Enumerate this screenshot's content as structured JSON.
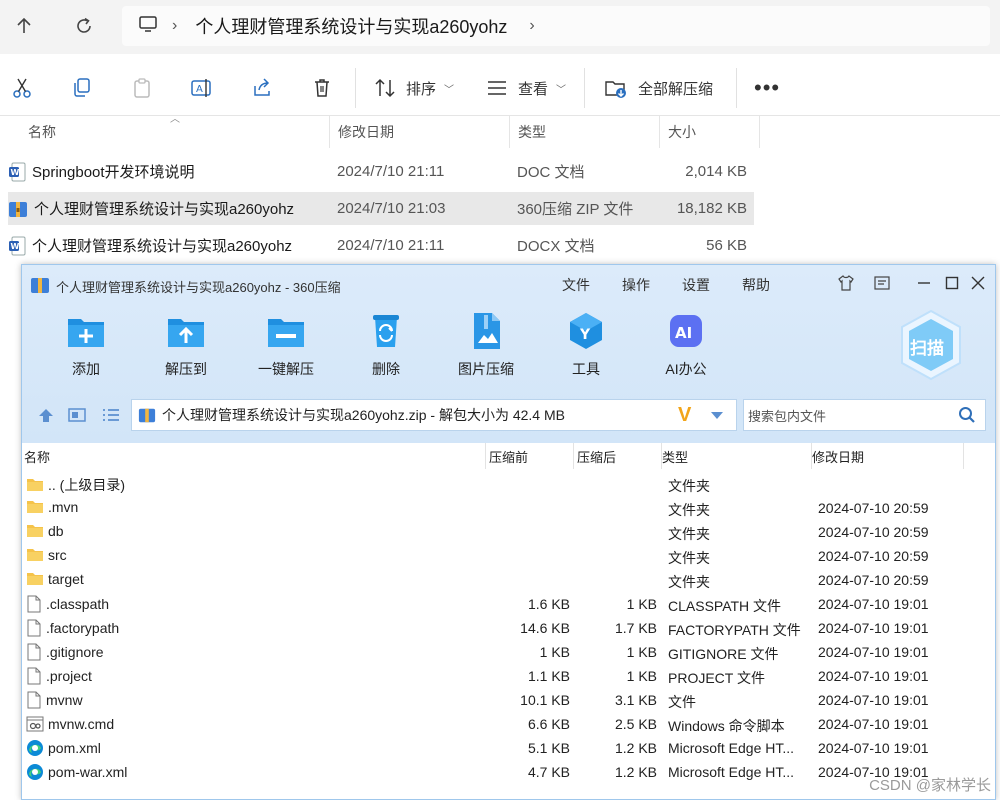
{
  "explorer": {
    "breadcrumb": "个人理财管理系统设计与实现a260yohz",
    "toolbar": {
      "sort_label": "排序",
      "view_label": "查看",
      "extract_all_label": "全部解压缩"
    },
    "columns": {
      "name": "名称",
      "modified": "修改日期",
      "type": "类型",
      "size": "大小"
    },
    "files": [
      {
        "name": "Springboot开发环境说明",
        "modified": "2024/7/10 21:11",
        "type": "DOC 文档",
        "size": "2,014 KB",
        "icon": "word-icon"
      },
      {
        "name": "个人理财管理系统设计与实现a260yohz",
        "modified": "2024/7/10 21:03",
        "type": "360压缩 ZIP 文件",
        "size": "18,182 KB",
        "icon": "zip-icon"
      },
      {
        "name": "个人理财管理系统设计与实现a260yohz",
        "modified": "2024/7/10 21:11",
        "type": "DOCX 文档",
        "size": "56 KB",
        "icon": "word-icon"
      }
    ]
  },
  "zip": {
    "title": "个人理财管理系统设计与实现a260yohz - 360压缩",
    "menu": [
      "文件",
      "操作",
      "设置",
      "帮助"
    ],
    "actions": [
      "添加",
      "解压到",
      "一键解压",
      "删除",
      "图片压缩",
      "工具",
      "AI办公"
    ],
    "scan_label": "扫描",
    "ai_badge": "AI",
    "path": "个人理财管理系统设计与实现a260yohz.zip - 解包大小为 42.4 MB",
    "search_placeholder": "搜索包内文件",
    "columns": {
      "name": "名称",
      "before": "压缩前",
      "after": "压缩后",
      "type": "类型",
      "modified": "修改日期"
    },
    "rows": [
      {
        "name": ".. (上级目录)",
        "before": "",
        "after": "",
        "type": "文件夹",
        "modified": "",
        "icon": "folder-icon"
      },
      {
        "name": ".mvn",
        "before": "",
        "after": "",
        "type": "文件夹",
        "modified": "2024-07-10 20:59",
        "icon": "folder-icon"
      },
      {
        "name": "db",
        "before": "",
        "after": "",
        "type": "文件夹",
        "modified": "2024-07-10 20:59",
        "icon": "folder-icon"
      },
      {
        "name": "src",
        "before": "",
        "after": "",
        "type": "文件夹",
        "modified": "2024-07-10 20:59",
        "icon": "folder-icon"
      },
      {
        "name": "target",
        "before": "",
        "after": "",
        "type": "文件夹",
        "modified": "2024-07-10 20:59",
        "icon": "folder-icon"
      },
      {
        "name": ".classpath",
        "before": "1.6 KB",
        "after": "1 KB",
        "type": "CLASSPATH 文件",
        "modified": "2024-07-10 19:01",
        "icon": "file-icon"
      },
      {
        "name": ".factorypath",
        "before": "14.6 KB",
        "after": "1.7 KB",
        "type": "FACTORYPATH 文件",
        "modified": "2024-07-10 19:01",
        "icon": "file-icon"
      },
      {
        "name": ".gitignore",
        "before": "1 KB",
        "after": "1 KB",
        "type": "GITIGNORE 文件",
        "modified": "2024-07-10 19:01",
        "icon": "file-icon"
      },
      {
        "name": ".project",
        "before": "1.1 KB",
        "after": "1 KB",
        "type": "PROJECT 文件",
        "modified": "2024-07-10 19:01",
        "icon": "file-icon"
      },
      {
        "name": "mvnw",
        "before": "10.1 KB",
        "after": "3.1 KB",
        "type": "文件",
        "modified": "2024-07-10 19:01",
        "icon": "file-icon"
      },
      {
        "name": "mvnw.cmd",
        "before": "6.6 KB",
        "after": "2.5 KB",
        "type": "Windows 命令脚本",
        "modified": "2024-07-10 19:01",
        "icon": "script-icon"
      },
      {
        "name": "pom.xml",
        "before": "5.1 KB",
        "after": "1.2 KB",
        "type": "Microsoft Edge HT...",
        "modified": "2024-07-10 19:01",
        "icon": "edge-icon"
      },
      {
        "name": "pom-war.xml",
        "before": "4.7 KB",
        "after": "1.2 KB",
        "type": "Microsoft Edge HT...",
        "modified": "2024-07-10 19:01",
        "icon": "edge-icon"
      }
    ]
  },
  "watermark": "CSDN @家林学长"
}
